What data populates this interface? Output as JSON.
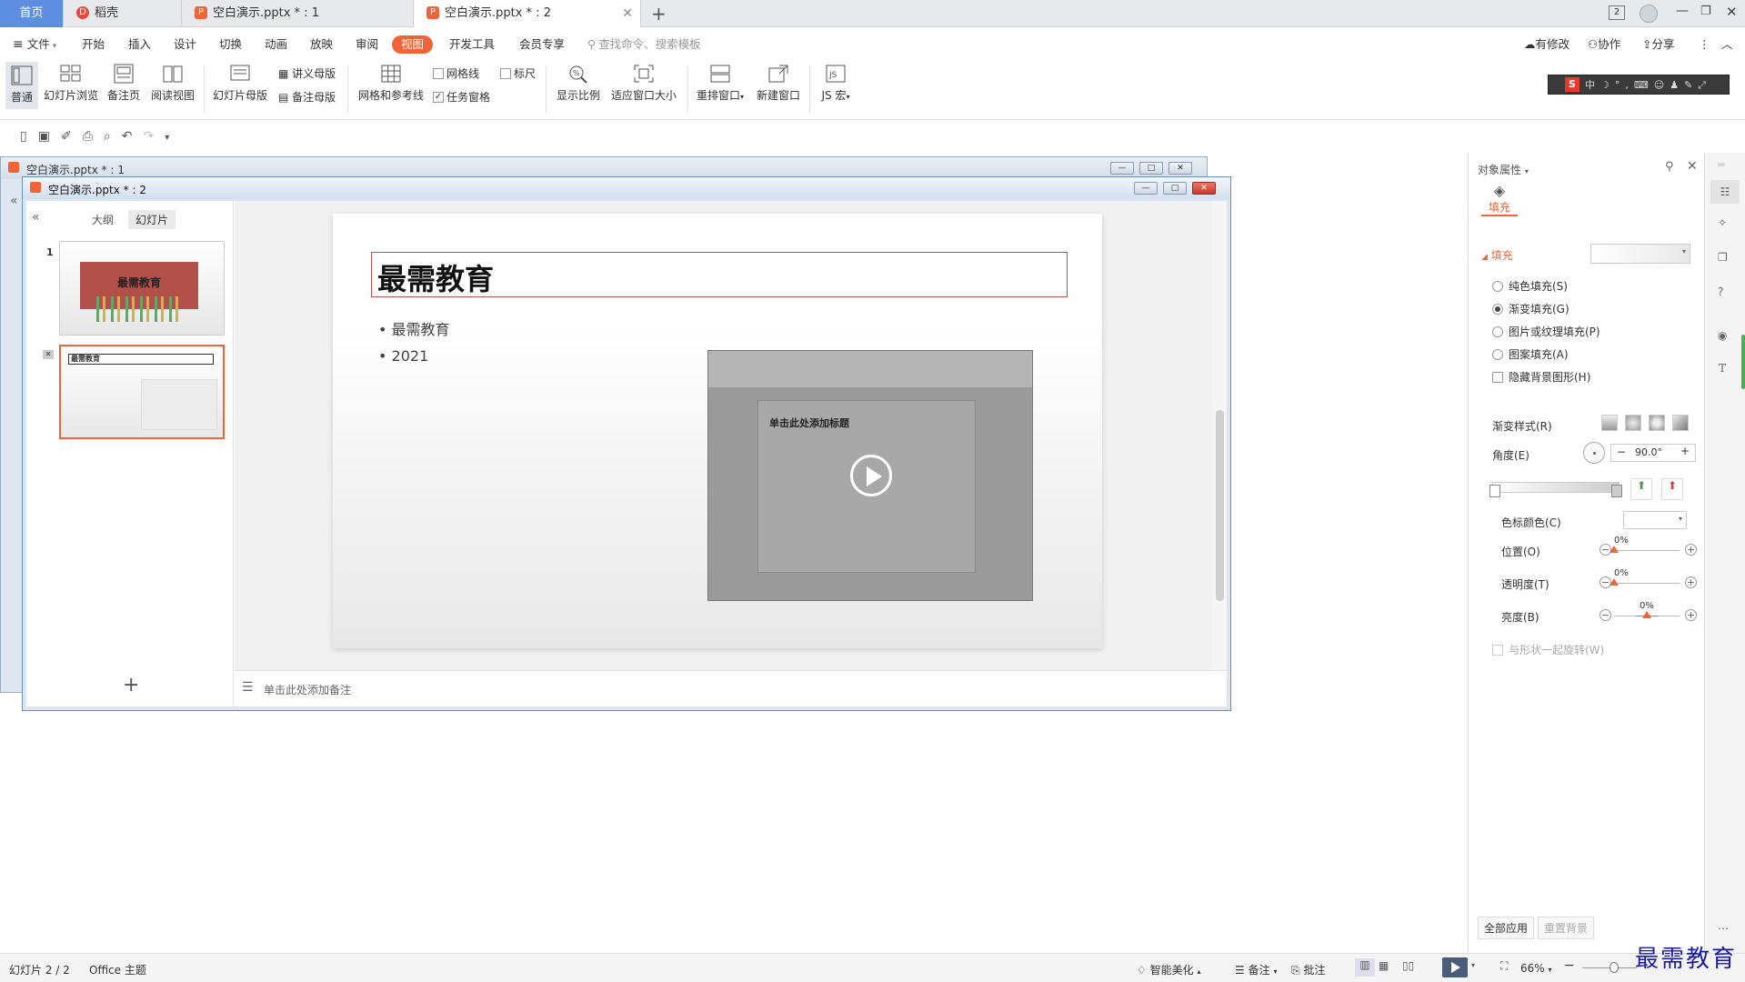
{
  "tabs": {
    "home": "首页",
    "daoke": "稻壳",
    "doc1": "空白演示.pptx * : 1",
    "doc2": "空白演示.pptx * : 2",
    "window_count": "2"
  },
  "menubar": {
    "file": "文件",
    "items": [
      "开始",
      "插入",
      "设计",
      "切换",
      "动画",
      "放映",
      "审阅",
      "视图",
      "开发工具",
      "会员专享"
    ],
    "search_placeholder": "查找命令、搜索模板",
    "modified": "有修改",
    "collab": "协作",
    "share": "分享"
  },
  "ribbon": {
    "normal": "普通",
    "slide_browse": "幻灯片浏览",
    "notes_page": "备注页",
    "reading_view": "阅读视图",
    "slide_master": "幻灯片母版",
    "handout_master": "讲义母版",
    "notes_master": "备注母版",
    "grid_guides": "网格和参考线",
    "gridlines": "网格线",
    "ruler": "标尺",
    "task_pane": "任务窗格",
    "zoom": "显示比例",
    "fit_window": "适应窗口大小",
    "arrange": "重排窗口",
    "new_window": "新建窗口",
    "js_macro": "JS 宏"
  },
  "window1": {
    "title": "空白演示.pptx * : 1"
  },
  "window2": {
    "title": "空白演示.pptx * : 2"
  },
  "slidepanel": {
    "tab_outline": "大纲",
    "tab_slides": "幻灯片",
    "thumbs": [
      {
        "num": "1",
        "title": "最需教育"
      },
      {
        "title": "最需教育"
      }
    ]
  },
  "slide": {
    "title": "最需教育",
    "bullets": [
      "最需教育",
      "2021"
    ],
    "video_placeholder_title": "单击此处添加标题"
  },
  "notes_placeholder": "单击此处添加备注",
  "rpanel": {
    "header": "对象属性",
    "tab": "填充",
    "section": "填充",
    "options": [
      "纯色填充(S)",
      "渐变填充(G)",
      "图片或纹理填充(P)",
      "图案填充(A)"
    ],
    "selected_option": 1,
    "hide_bg": "隐藏背景图形(H)",
    "gradient_style": "渐变样式(R)",
    "angle_label": "角度(E)",
    "angle_value": "90.0°",
    "stop_color": "色标颜色(C)",
    "position": "位置(O)",
    "transparency": "透明度(T)",
    "brightness": "亮度(B)",
    "position_value": "0%",
    "transparency_value": "0%",
    "brightness_value": "0%",
    "brightness_level": 0.5,
    "rotate_with_shape": "与形状一起旋转(W)",
    "apply_all": "全部应用",
    "reset_bg": "重置背景"
  },
  "status": {
    "slide_info": "幻灯片 2 / 2",
    "theme": "Office 主题",
    "beautify": "智能美化",
    "notes": "备注",
    "comments": "批注",
    "zoom": "66%"
  },
  "watermark": "最需教育",
  "colors": {
    "accent": "#f06438",
    "tab_active": "#5c8fe0",
    "title_box": "#c0504d"
  }
}
